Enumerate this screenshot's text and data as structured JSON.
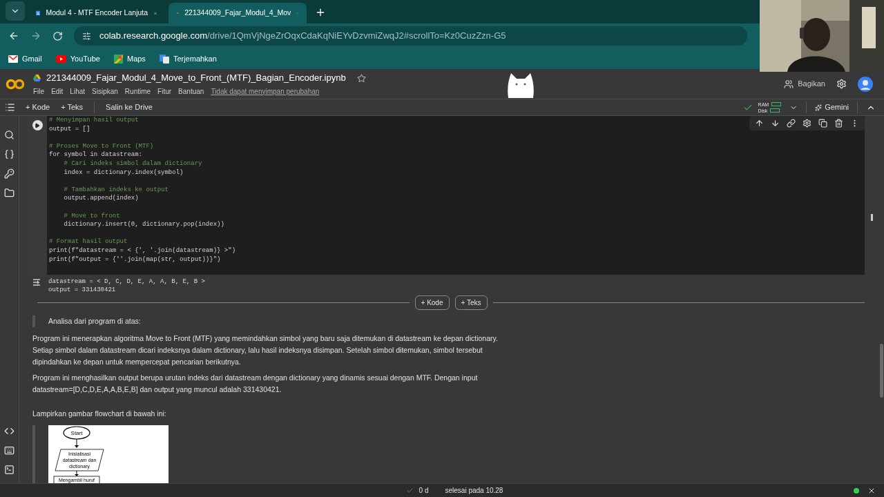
{
  "browser": {
    "tabs": [
      {
        "title": "Modul 4 - MTF Encoder Lanjuta",
        "selected": false
      },
      {
        "title": "221344009_Fajar_Modul_4_Mov",
        "selected": true
      }
    ],
    "url_host": "colab.research.google.com",
    "url_path": "/drive/1QmVjNgeZrOqxCdaKqNiEYvDzvmiZwqJ2#scrollTo=Kz0CuzZzn-G5",
    "bookmarks": [
      {
        "label": "Gmail"
      },
      {
        "label": "YouTube"
      },
      {
        "label": "Maps"
      },
      {
        "label": "Terjemahkan"
      }
    ]
  },
  "webcam": {
    "kind": "picture"
  },
  "notebook": {
    "title": "221344009_Fajar_Modul_4_Move_to_Front_(MTF)_Bagian_Encoder.ipynb",
    "menu": [
      "File",
      "Edit",
      "Lihat",
      "Sisipkan",
      "Runtime",
      "Fitur",
      "Bantuan"
    ],
    "save_notice": "Tidak dapat menyimpan perubahan",
    "share": "Bagikan",
    "toolbar": [
      "+ Kode",
      "+ Teks",
      "Salin ke Drive"
    ],
    "ram": "RAM",
    "disk": "Disk",
    "gemini": "Gemini"
  },
  "code_cell": {
    "lines": [
      {
        "kind": "comment",
        "text": "# Menyimpan hasil output"
      },
      {
        "kind": "code",
        "text": "output = []"
      },
      {
        "kind": "blank"
      },
      {
        "kind": "comment",
        "text": "# Proses Move to Front (MTF)"
      },
      {
        "kind": "code",
        "text": "for symbol in datastream:"
      },
      {
        "kind": "comment",
        "text": "    # Cari indeks simbol dalam dictionary"
      },
      {
        "kind": "code",
        "text": "    index = dictionary.index(symbol)"
      },
      {
        "kind": "blank"
      },
      {
        "kind": "comment",
        "text": "    # Tambahkan indeks ke output"
      },
      {
        "kind": "code",
        "text": "    output.append(index)"
      },
      {
        "kind": "blank"
      },
      {
        "kind": "comment",
        "text": "    # Move to front"
      },
      {
        "kind": "code",
        "text": "    dictionary.insert(0, dictionary.pop(index))"
      },
      {
        "kind": "blank"
      },
      {
        "kind": "comment",
        "text": "# Format hasil output"
      },
      {
        "kind": "code",
        "text": "print(f\"datastream = < {', '.join(datastream)} >\")"
      },
      {
        "kind": "code",
        "text": "print(f\"output = {''.join(map(str, output))}\")"
      }
    ],
    "output": [
      "datastream = < D, C, D, E, A, A, B, E, B >",
      "output = 331430421"
    ]
  },
  "add_buttons": [
    "+ Kode",
    "+ Teks"
  ],
  "text_cell": {
    "quote": "Analisa dari program di atas:",
    "paragraphs": [
      "Program ini menerapkan algoritma Move to Front (MTF) yang memindahkan simbol yang baru saja ditemukan di datastream ke depan dictionary. Setiap simbol dalam datastream dicari indeksnya dalam dictionary, lalu hasil indeksnya disimpan. Setelah simbol ditemukan, simbol tersebut dipindahkan ke depan untuk mempercepat pencarian berikutnya.",
      "Program ini menghasilkan output berupa urutan indeks dari datastream dengan dictionary yang dinamis sesuai dengan MTF. Dengan input datastream=[D,C,D,E,A,A,B,E,B] dan output yang muncul adalah 331430421."
    ],
    "prompt": "Lampirkan gambar flowchart di bawah ini:",
    "flowchart": {
      "start": "Start",
      "init": [
        "Inisialisasi",
        "datastream dan",
        "dictionary"
      ],
      "step": "Mengambil huruf"
    }
  },
  "status": {
    "elapsed": "0 d",
    "finished": "selesai pada 10.28"
  }
}
